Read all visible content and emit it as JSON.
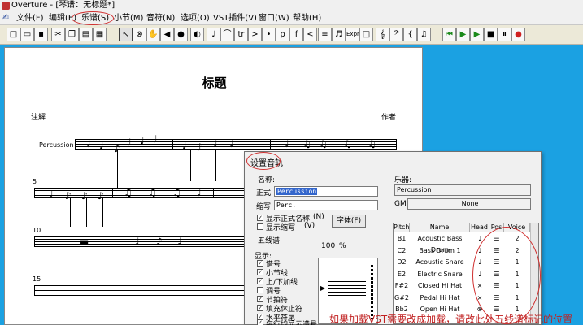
{
  "window": {
    "title": "Overture - [琴谱：无标题*]"
  },
  "menu": [
    "文件(F)",
    "编辑(E)",
    "乐谱(S)",
    "小节(M)",
    "音符(N)",
    "选项(O)",
    "VST插件(V)",
    "窗口(W)",
    "帮助(H)"
  ],
  "toolbar": {
    "buttons": [
      "new",
      "open",
      "save",
      "cut",
      "copy",
      "paste",
      "print",
      "pointer",
      "eraser",
      "hand",
      "speaker",
      "palette",
      "note",
      "slur",
      "tr",
      "accent",
      "staccato",
      "dynamic-p",
      "dynamic-f",
      "hairpin",
      "beam",
      "tuplet",
      "expr",
      "rect",
      "treble-clef",
      "bass-clef",
      "brace",
      "rewind",
      "play-from",
      "play",
      "stop",
      "pause",
      "record"
    ],
    "labels": {
      "tr": "tr",
      "accent": ">",
      "p": "p",
      "f": "f",
      "expr": "Expr"
    }
  },
  "score": {
    "title": "标题",
    "lyricist": "注解",
    "composer": "作者",
    "instrument": "Percussion",
    "measure_numbers": [
      "5",
      "10",
      "15"
    ]
  },
  "dialog": {
    "title": "设置音轨",
    "name_label": "名称:",
    "full_label": "正式",
    "full_value": "Percussion",
    "abbr_label": "缩写",
    "abbr_value": "Perc.",
    "show_full": "显示正式名称",
    "show_full_key": "(N)",
    "show_abbr": "显示缩写",
    "show_abbr_key": "(V)",
    "font_button": "字体(F)",
    "staff_label": "五线谱:",
    "staff_percent": "100",
    "percent_sign": "%",
    "display_label": "显示:",
    "display_items": [
      "谱号",
      "小节线",
      "上/下加线",
      "调号",
      "节拍符",
      "填充休止符",
      "水平符尾",
      "每行均显示谱号"
    ],
    "instrument_label": "乐器:",
    "instrument_value": "Percussion",
    "gm_label": "GM",
    "gm_value": "None",
    "table_headers": [
      "Pitch",
      "Name",
      "Head",
      "Pos",
      "Voice"
    ],
    "table_rows": [
      {
        "pitch": "B1",
        "name": "Acoustic Bass Drum",
        "voice": "2"
      },
      {
        "pitch": "C2",
        "name": "Bass Drum 1",
        "voice": "2"
      },
      {
        "pitch": "D2",
        "name": "Acoustic Snare",
        "voice": "1"
      },
      {
        "pitch": "E2",
        "name": "Electric Snare",
        "voice": "1"
      },
      {
        "pitch": "F#2",
        "name": "Closed Hi Hat",
        "voice": "1"
      },
      {
        "pitch": "G#2",
        "name": "Pedal Hi Hat",
        "voice": "1"
      },
      {
        "pitch": "Bb2",
        "name": "Open Hi Hat",
        "voice": "1"
      }
    ]
  },
  "annotation": "如果加载VST需要改成加载，请改此处五线谱标记的位置",
  "colors": {
    "desktop": "#1ba1e2",
    "highlight": "#d03030",
    "input_select": "#3366cc"
  }
}
